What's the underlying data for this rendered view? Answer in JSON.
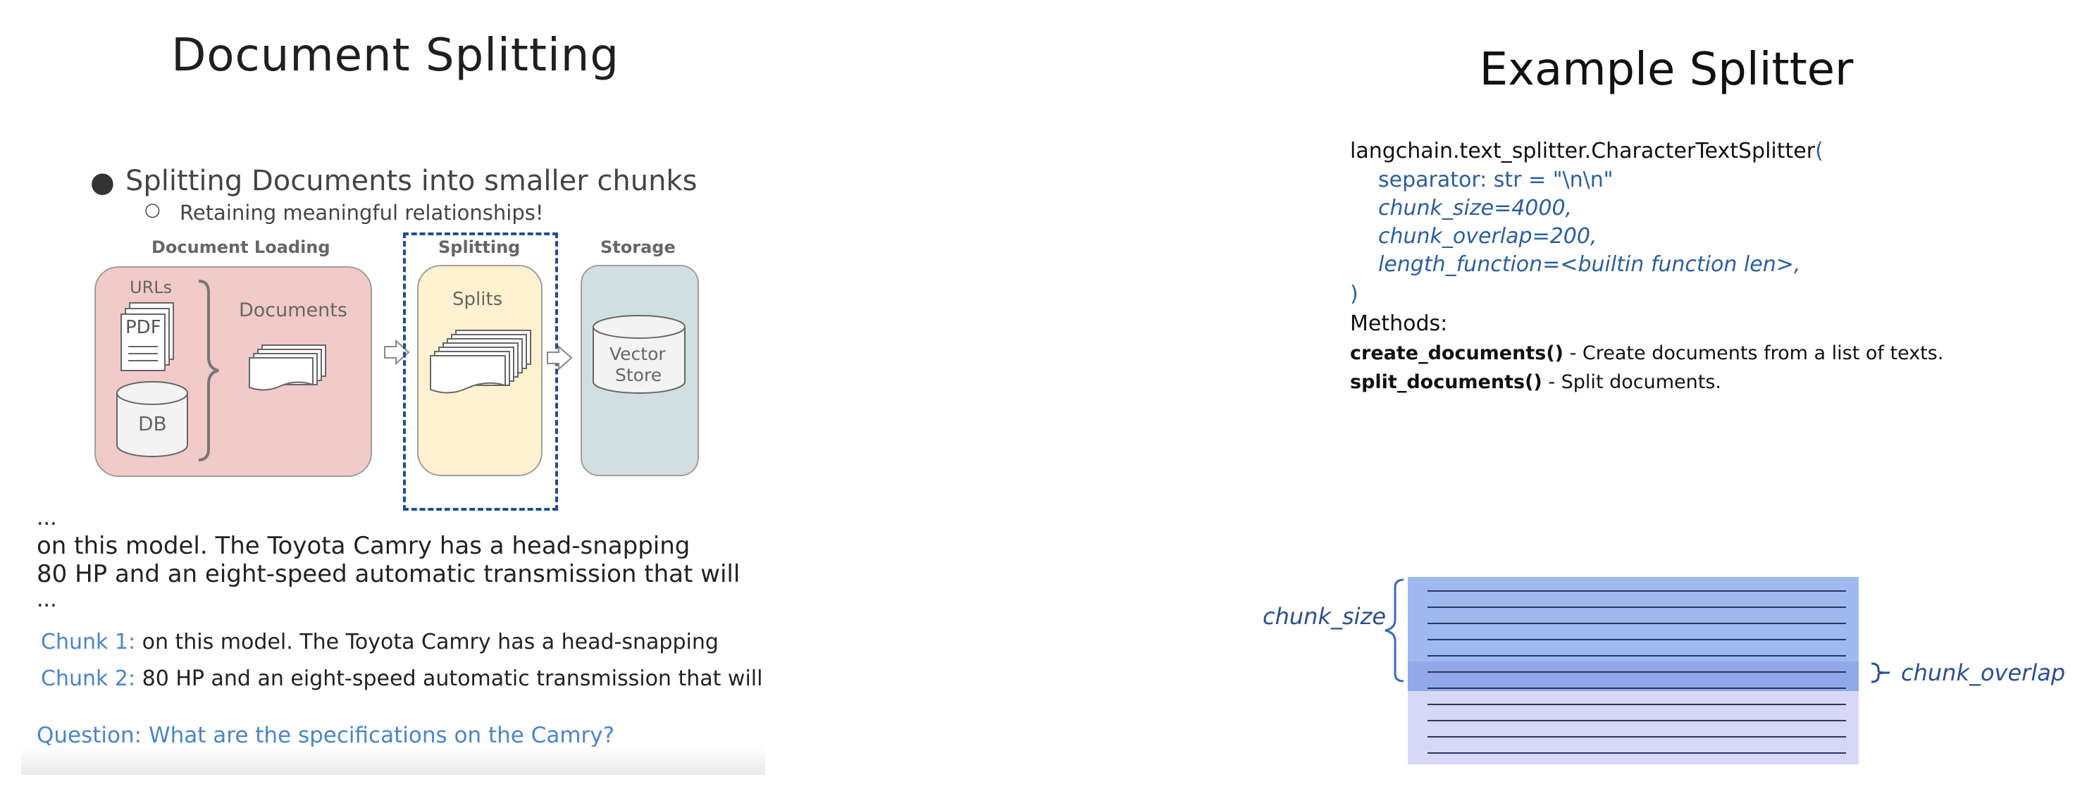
{
  "left_slide": {
    "title": "Document Splitting",
    "bullet_main": "Splitting Documents into smaller chunks",
    "bullet_sub": "Retaining meaningful relationships!",
    "bullet_main_marker": "●",
    "bullet_sub_marker": "○",
    "diagram": {
      "stages": {
        "loading": "Document Loading",
        "splitting": "Splitting",
        "storage": "Storage"
      },
      "urls": "URLs",
      "pdf": "PDF",
      "db": "DB",
      "documents": "Documents",
      "splits": "Splits",
      "vector_store_line1": "Vector",
      "vector_store_line2": "Store",
      "colors": {
        "loading_bg": "#f2caca",
        "splitting_bg": "#fdf1cf",
        "storage_bg": "#d2dfe2",
        "highlight_border": "#1f4e94"
      }
    },
    "ellipsis": "...",
    "passage_line1": "on this model. The Toyota Camry has a head-snapping",
    "passage_line2": "80 HP and an eight-speed automatic transmission that will",
    "chunks": [
      {
        "label": "Chunk 1:",
        "text": " on this model. The Toyota Camry has a head-snapping"
      },
      {
        "label": "Chunk 2:",
        "text": " 80 HP and an eight-speed automatic transmission that will"
      }
    ],
    "question": "Question: What are the specifications on the Camry?"
  },
  "right_slide": {
    "title": "Example Splitter",
    "code": {
      "line1": "langchain.text_splitter.CharacterTextSplitter",
      "open_paren": "(",
      "separator": "separator: str = \"\\n\\n\"",
      "chunk_size": "chunk_size=4000,",
      "chunk_overlap": "chunk_overlap=200,",
      "length_function": "length_function=<builtin function len>,",
      "close_paren": ")"
    },
    "methods_label": "Methods:",
    "methods": [
      {
        "name": "create_documents()",
        "desc": " - Create documents from a list of texts."
      },
      {
        "name": "split_documents()",
        "desc": " - Split documents."
      }
    ],
    "chunk_diagram": {
      "chunk_size_label": "chunk_size",
      "chunk_overlap_label": "chunk_overlap",
      "colors": {
        "chunk1": "#9fbaf0",
        "overlap": "#93abea",
        "chunk2": "#d6d8f6"
      }
    }
  }
}
